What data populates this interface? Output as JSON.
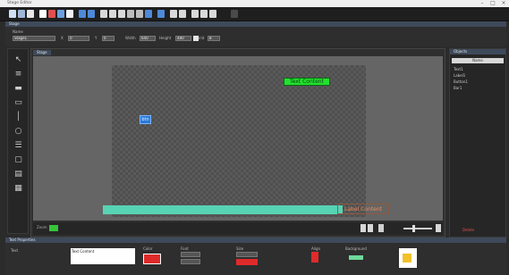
{
  "window": {
    "title": "Stage Editor"
  },
  "toolbar": {
    "icons": [
      "new-icon",
      "open-icon",
      "save-icon",
      "cut-icon",
      "copy-icon",
      "paste-icon",
      "delete-icon",
      "undo-icon",
      "redo-icon",
      "run-icon",
      "stop-icon",
      "grid-icon",
      "align-left-icon",
      "align-center-icon",
      "align-right-icon",
      "zoom-in-icon",
      "zoom-out-icon",
      "fit-icon",
      "layer-up-icon",
      "layer-down-icon",
      "settings-icon"
    ]
  },
  "properties": {
    "title": "Stage",
    "labels": {
      "name": "Name",
      "x": "X",
      "y": "Y",
      "w": "Width",
      "h": "Height",
      "grid": "Grid"
    },
    "values": {
      "name": "Stage1",
      "x": "0",
      "y": "0",
      "w": "640",
      "h": "480",
      "grid": "8"
    }
  },
  "tools": {
    "icons": [
      "select-tool-icon",
      "text-tool-icon",
      "image-tool-icon",
      "shape-tool-icon",
      "line-tool-icon",
      "button-tool-icon",
      "list-tool-icon",
      "frame-tool-icon",
      "input-tool-icon",
      "note-tool-icon"
    ]
  },
  "canvas": {
    "tab_label": "Stage",
    "green_label": "Text Content",
    "blue_label": "btn",
    "orange_label": "Label Content",
    "status_text": "Zoom",
    "status_green": "On"
  },
  "objects": {
    "title": "Objects",
    "header": "Name",
    "rows": [
      "Text1",
      "Label1",
      "Button1",
      "Bar1"
    ],
    "footer": "Delete"
  },
  "bottom": {
    "title": "Text Properties",
    "text_label": "Text",
    "text_value": "Text Content",
    "color_label": "Color",
    "font_label": "Font",
    "size_label": "Size",
    "align_label": "Align",
    "bg_label": "Background"
  },
  "colors": {
    "accent_green": "#23e02f",
    "accent_blue": "#2a79d6",
    "teal": "#58d3b4",
    "orange": "#f08a55",
    "red": "#e02a2a"
  }
}
